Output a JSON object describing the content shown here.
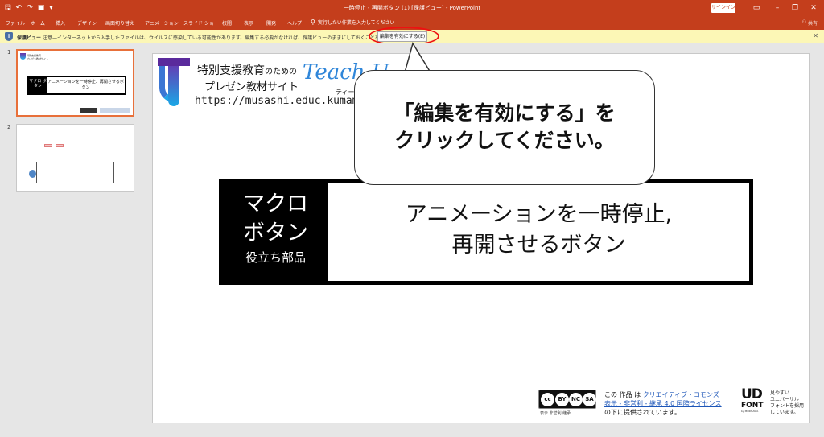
{
  "window": {
    "title": "一時停止・再開ボタン (1) [保護ビュー] - PowerPoint",
    "signin_label": "サインイン"
  },
  "ribbon": {
    "tabs": [
      "ファイル",
      "ホーム",
      "挿入",
      "デザイン",
      "画面切り替え",
      "アニメーション",
      "スライド ショー",
      "校閲",
      "表示",
      "開発",
      "ヘルプ"
    ],
    "tellme": "実行したい作業を入力してください",
    "share": "共有"
  },
  "protected_view": {
    "label": "保護ビュー",
    "message": "注意—インターネットから入手したファイルは、ウイルスに感染している可能性があります。編集する必要がなければ、保護ビューのままにしておくことをお勧めします。",
    "enable_button": "編集を有効にする(E)"
  },
  "thumbnails": {
    "numbers": [
      "1",
      "2"
    ],
    "slide1_title_black": "マクロ ボタン",
    "slide1_title_white": "アニメーションを一時停止、再開させるボタン"
  },
  "slide": {
    "site_line1": "特別支援教育",
    "site_line1_small": "のための",
    "site_line2": "プレゼン教材サイト",
    "site_url": "https://musashi.educ.kumamoto-u.ac.jp/",
    "teach_logo": "Teach U",
    "teach_sub": "ティーチ",
    "callout_line1": "「編集を有効にする」を",
    "callout_line2": "クリックしてください。",
    "title_black_1": "マクロ",
    "title_black_2": "ボタン",
    "title_black_3": "役立ち部品",
    "title_white_1": "アニメーションを一時停止,",
    "title_white_2": "再開させるボタン",
    "cc_symbols": [
      "cc",
      "BY",
      "NC",
      "SA"
    ],
    "cc_labels": "表示 非営利 継承",
    "license_line1_pre": "この 作品 は ",
    "license_link1": "クリエイティブ・コモンズ",
    "license_link2": "表示 - 非営利 - 継承 4.0 国際ライセンス",
    "license_line3": "の下に提供されています。",
    "ud_logo": "UD",
    "ud_font": "FONT",
    "ud_by": "by MORISAWA",
    "ud_desc": [
      "見やすい",
      "ユニバーサル",
      "フォントを採用",
      "しています。"
    ]
  },
  "colors": {
    "accent": "#c43e1c",
    "protected_bar": "#fcf7b6",
    "callout_highlight": "#e11111",
    "link": "#1d56b8"
  }
}
